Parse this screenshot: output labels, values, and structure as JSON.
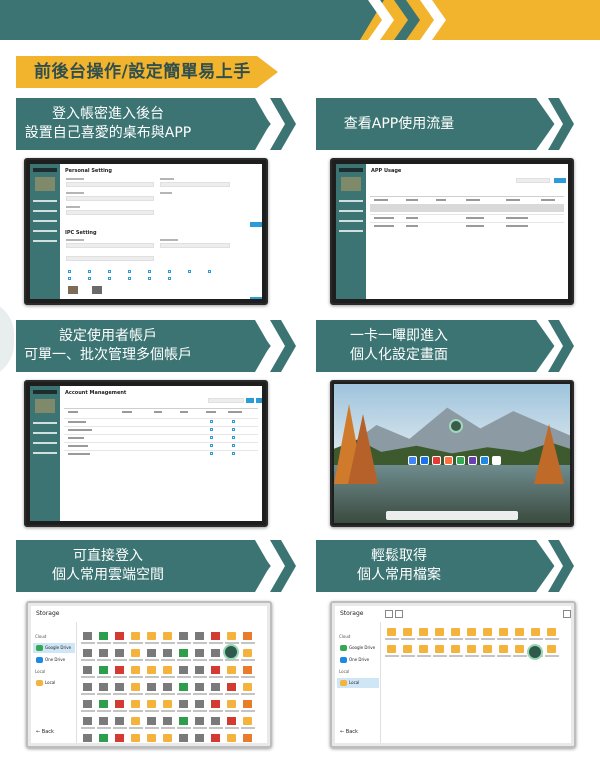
{
  "headline": "前後台操作/設定簡單易上手",
  "colors": {
    "teal": "#3b7473",
    "gold": "#f2b32d",
    "white": "#ffffff"
  },
  "features": [
    {
      "line1": "登入帳密進入後台",
      "line2": "設置自己喜愛的桌布與APP",
      "screen_title": "Personal Setting",
      "screen_subtitle": "IPC Setting"
    },
    {
      "line1": "查看APP使用流量",
      "line2": "",
      "screen_title": "APP Usage"
    },
    {
      "line1": "設定使用者帳戶",
      "line2": "可單一、批次管理多個帳戶",
      "screen_title": "Account Management"
    },
    {
      "line1": "一卡一嗶即進入",
      "line2": "個人化設定畫面"
    },
    {
      "line1": "可直接登入",
      "line2": "個人常用雲端空間",
      "screen_title": "Storage",
      "cloud_caption": "Cloud",
      "cloud_items": [
        "Google Drive",
        "One Drive"
      ],
      "local_caption": "Local",
      "local_item": "Local",
      "back_label": "Back"
    },
    {
      "line1": "輕鬆取得",
      "line2": "個人常用檔案",
      "screen_title": "Storage",
      "cloud_caption": "Cloud",
      "cloud_items": [
        "Google Drive",
        "One Drive"
      ],
      "local_caption": "Local",
      "local_item": "Local",
      "back_label": "Back"
    }
  ]
}
